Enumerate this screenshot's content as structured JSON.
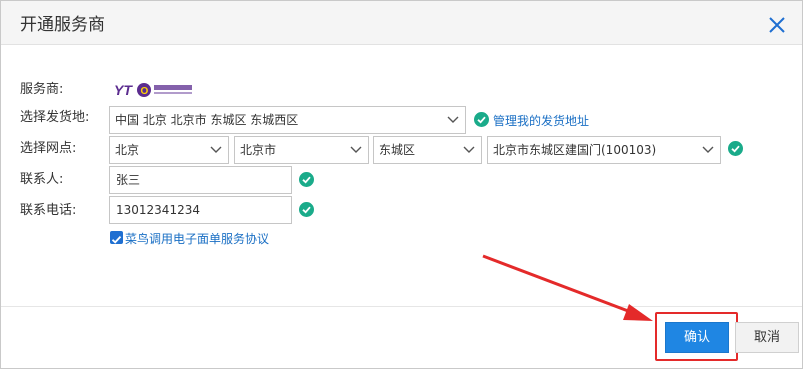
{
  "dialog": {
    "title": "开通服务商"
  },
  "form": {
    "provider_label": "服务商:",
    "provider_logo_name": "yto-logo",
    "ship_address_label": "选择发货地:",
    "ship_address_value": "中国 北京 北京市 东城区 东城西区",
    "manage_address_link": "管理我的发货地址",
    "outlet_label": "选择网点:",
    "outlet_province": "北京",
    "outlet_city": "北京市",
    "outlet_district": "东城区",
    "outlet_branch": "北京市东城区建国门(100103)",
    "contact_label": "联系人:",
    "contact_value": "张三",
    "phone_label": "联系电话:",
    "phone_value": "13012341234",
    "agreement_label": "菜鸟调用电子面单服务协议",
    "agreement_checked": true
  },
  "buttons": {
    "confirm": "确认",
    "cancel": "取消"
  },
  "colors": {
    "accent": "#1f86e3",
    "link": "#1a6fc4",
    "check_ok": "#1aab8a",
    "annotation_red": "#e42a2a"
  }
}
